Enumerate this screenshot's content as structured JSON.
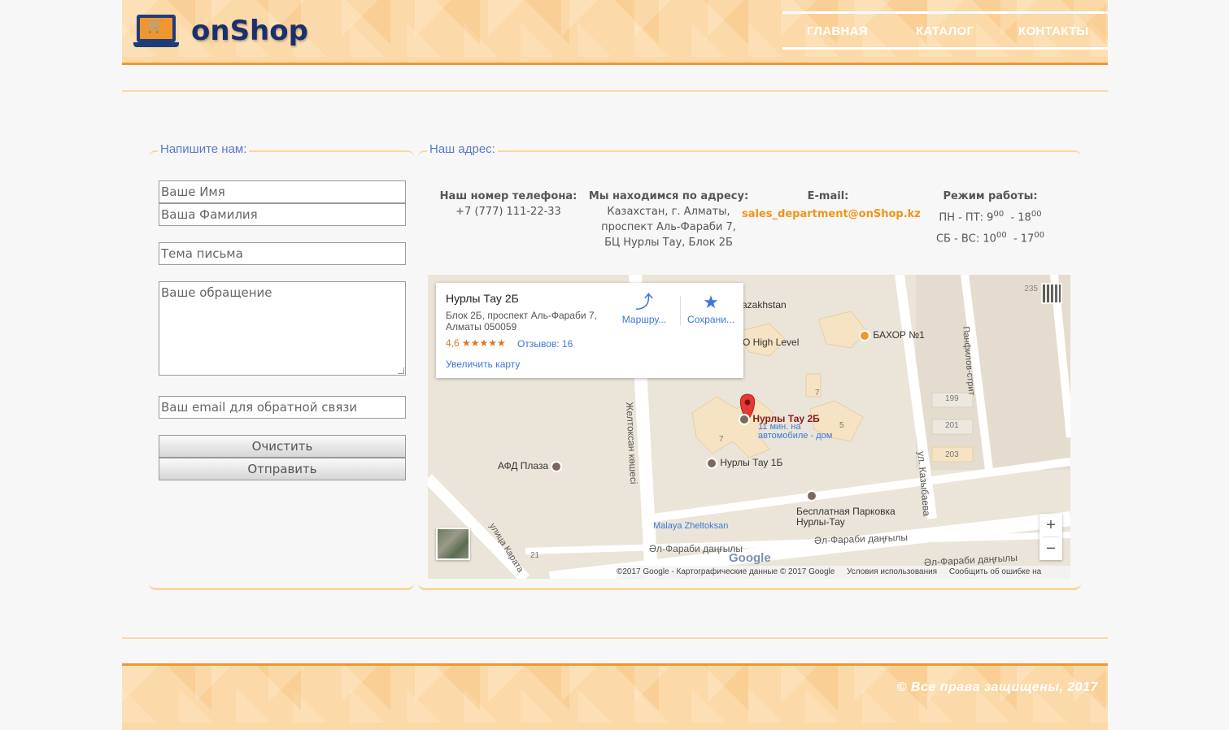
{
  "header": {
    "logo_text": "onShop",
    "nav": [
      "ГЛАВНАЯ",
      "КАТАЛОГ",
      "КОНТАКТЫ"
    ]
  },
  "write_panel": {
    "title": "Напишите нам:",
    "first_name_placeholder": "Ваше Имя",
    "last_name_placeholder": "Ваша Фамилия",
    "subject_placeholder": "Тема письма",
    "message_placeholder": "Ваше обращение",
    "email_placeholder": "Ваш email для обратной связи",
    "clear_label": "Очистить",
    "send_label": "Отправить"
  },
  "address_panel": {
    "title": "Наш адрес:",
    "phone_label": "Наш номер телефона:",
    "phone": "+7 (777) 111-22-33",
    "address_label": "Мы находимся по адресу:",
    "address_lines": [
      "Казахстан, г. Алматы,",
      "проспект Аль-Фараби 7,",
      "БЦ Нурлы Тау, Блок 2Б"
    ],
    "email_label": "E-mail:",
    "email": "sales_department@onShop.kz",
    "hours_label": "Режим работы:",
    "hours": {
      "weekdays": "ПН - ПТ:",
      "weekdays_from": "9",
      "weekdays_to": "18",
      "weekend": "СБ - ВС:",
      "weekend_from": "10",
      "weekend_to": "17",
      "minutes": "00"
    }
  },
  "map": {
    "card_title": "Нурлы Тау 2Б",
    "card_address_1": "Блок 2Б, проспект Аль-Фараби 7,",
    "card_address_2": "Алматы 050059",
    "rating": "4,6 ★★★★★",
    "reviews": "Отзывов: 16",
    "enlarge": "Увеличить карту",
    "route": "Маршру...",
    "save": "Сохрани...",
    "labels": {
      "pin": "Нурлы Тау 2Б",
      "pin_sub_1": "11 мин. на",
      "pin_sub_2": "автомобиле - дом",
      "nurly1b": "Нурлы Тау 1Б",
      "afd": "АФД Плаза",
      "bahor": "БАХОР №1",
      "highlevel": "O High Level",
      "kazakhstan": "azakhstan",
      "parking1": "Бесплатная Парковка",
      "parking2": "Нурлы-Тау",
      "malaya": "Malaya Zheltoksan",
      "alfarabi1": "Әл-Фараби даңғылы",
      "alfarabi2": "Әл-Фараби даңғылы",
      "alfarabi3": "Әл-Фараби даңғылы",
      "zheltoksan": "Желтоксан көшесі",
      "kazybaeva": "ул. Казыбаева",
      "panfilov": "Панфилов-стрит",
      "karatal": "улица Карата",
      "num199": "199",
      "num201": "201",
      "num203": "203",
      "num21": "21",
      "num7a": "7",
      "num7b": "7",
      "num5": "5",
      "num235": "235"
    },
    "zoom_in": "+",
    "zoom_out": "−",
    "google": "Google",
    "attr_data": "©2017 Google - Картографические данные © 2017 Google",
    "attr_terms": "Условия использования",
    "attr_report": "Сообщить об ошибке на карте"
  },
  "footer": {
    "copyright": "© Все права защищены, 2017"
  },
  "colors": {
    "accent": "#f0962c",
    "header_bg": "#fbd9a8",
    "title_blue": "#5a7ac8",
    "logo_blue": "#1a2f6e"
  }
}
